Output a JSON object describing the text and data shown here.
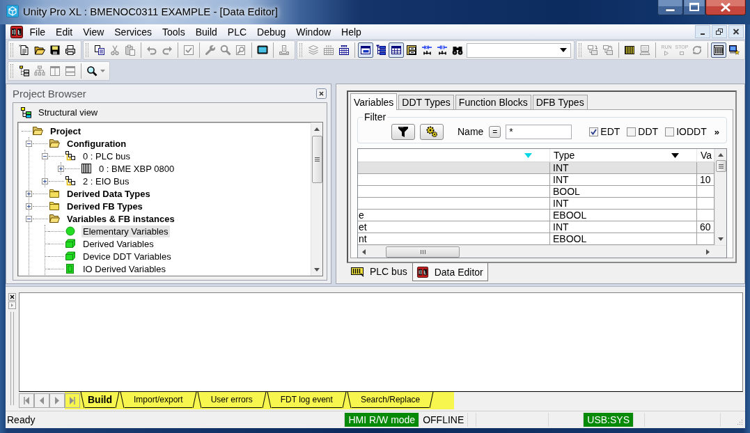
{
  "window": {
    "title": "Unity Pro XL : BMENOC0311 EXAMPLE - [Data Editor]"
  },
  "menu": [
    "File",
    "Edit",
    "View",
    "Services",
    "Tools",
    "Build",
    "PLC",
    "Debug",
    "Window",
    "Help"
  ],
  "toolbar_rows": [
    {
      "bands": [
        {
          "groups": [
            [
              {
                "kind": "new",
                "disabled": false,
                "pressed": false
              },
              {
                "kind": "open",
                "disabled": false,
                "pressed": false
              },
              {
                "kind": "save",
                "disabled": false,
                "pressed": false
              },
              {
                "kind": "print",
                "disabled": false,
                "pressed": false
              }
            ]
          ]
        },
        {
          "groups": [
            [
              {
                "kind": "copy",
                "disabled": false,
                "pressed": false
              },
              {
                "kind": "cut",
                "disabled": true,
                "pressed": false
              },
              {
                "kind": "paste",
                "disabled": true,
                "pressed": false
              }
            ],
            [
              {
                "kind": "undo",
                "disabled": true,
                "pressed": false
              },
              {
                "kind": "redo",
                "disabled": true,
                "pressed": false
              }
            ],
            [
              {
                "kind": "check",
                "disabled": true,
                "pressed": false
              }
            ],
            [
              {
                "kind": "wrench",
                "disabled": true,
                "pressed": false
              },
              {
                "kind": "magnifier",
                "disabled": true,
                "pressed": false
              },
              {
                "kind": "zoompage",
                "disabled": true,
                "pressed": false
              }
            ],
            [
              {
                "kind": "monitor",
                "disabled": false,
                "pressed": false
              }
            ],
            [
              {
                "kind": "export",
                "disabled": true,
                "pressed": false
              }
            ]
          ]
        },
        {
          "groups": [
            [
              {
                "kind": "stack",
                "disabled": true,
                "pressed": false
              },
              {
                "kind": "grid",
                "disabled": true,
                "pressed": false
              },
              {
                "kind": "gridin",
                "disabled": false,
                "pressed": false
              }
            ],
            [
              {
                "kind": "window",
                "disabled": false,
                "pressed": true
              },
              {
                "kind": "tree",
                "disabled": false,
                "pressed": false
              },
              {
                "kind": "table",
                "disabled": false,
                "pressed": true
              },
              {
                "kind": "cabinet",
                "disabled": false,
                "pressed": false
              },
              {
                "kind": "contact",
                "disabled": false,
                "pressed": false
              },
              {
                "kind": "coil",
                "disabled": false,
                "pressed": false
              },
              {
                "kind": "binoculars",
                "disabled": false,
                "pressed": false
              }
            ]
          ],
          "combo": true
        },
        {
          "groups": [
            [
              {
                "kind": "download",
                "disabled": true,
                "pressed": false
              },
              {
                "kind": "upload",
                "disabled": true,
                "pressed": false
              }
            ],
            [
              {
                "kind": "rack",
                "disabled": false,
                "pressed": false
              },
              {
                "kind": "computer",
                "disabled": true,
                "pressed": false
              }
            ],
            [
              {
                "kind": "run",
                "label": "RUN",
                "disabled": true,
                "pressed": false
              },
              {
                "kind": "stop",
                "label": "STOP",
                "disabled": true,
                "pressed": false
              },
              {
                "kind": "cycle",
                "disabled": true,
                "pressed": false
              }
            ],
            [
              {
                "kind": "rackview",
                "disabled": false,
                "pressed": true
              },
              {
                "kind": "station",
                "disabled": false,
                "pressed": false
              }
            ]
          ]
        }
      ]
    },
    {
      "bands": [
        {
          "groups": [
            [
              {
                "kind": "treeview",
                "disabled": false,
                "pressed": false
              },
              {
                "kind": "hierarchy",
                "disabled": true,
                "pressed": false
              },
              {
                "kind": "columns",
                "disabled": true,
                "pressed": false
              },
              {
                "kind": "rows",
                "disabled": true,
                "pressed": false
              }
            ],
            [
              {
                "kind": "zoom",
                "disabled": false,
                "pressed": false
              }
            ]
          ]
        }
      ]
    }
  ],
  "project_browser": {
    "title": "Project Browser",
    "view": "Structural view",
    "tree": [
      {
        "label": "Project",
        "kind": "folder",
        "expanded": true,
        "selected": false,
        "children": [
          {
            "label": "Configuration",
            "kind": "folder",
            "expanded": true,
            "selected": false,
            "children": [
              {
                "label": "0 : PLC bus",
                "kind": "bus",
                "expanded": true,
                "selected": false,
                "children": [
                  {
                    "label": "0 : BME XBP 0800",
                    "kind": "rack",
                    "expanded": false,
                    "selected": false
                  }
                ]
              },
              {
                "label": "2 : EIO Bus",
                "kind": "bus",
                "expanded": false,
                "selected": false
              }
            ]
          },
          {
            "label": "Derived Data Types",
            "kind": "folder",
            "expanded": false,
            "selected": false
          },
          {
            "label": "Derived FB Types",
            "kind": "folder",
            "expanded": false,
            "selected": false
          },
          {
            "label": "Variables & FB instances",
            "kind": "folder",
            "expanded": true,
            "selected": false,
            "children": [
              {
                "label": "Elementary Variables",
                "kind": "elementary",
                "selected": true
              },
              {
                "label": "Derived Variables",
                "kind": "derived",
                "selected": false
              },
              {
                "label": "Device DDT Variables",
                "kind": "device",
                "selected": false
              },
              {
                "label": "IO Derived Variables",
                "kind": "io",
                "selected": false
              }
            ]
          }
        ]
      }
    ]
  },
  "data_editor": {
    "tabs": [
      {
        "label": "Variables",
        "selected": true
      },
      {
        "label": "DDT Types",
        "selected": false
      },
      {
        "label": "Function Blocks",
        "selected": false
      },
      {
        "label": "DFB Types",
        "selected": false
      }
    ],
    "filter": {
      "legend": "Filter",
      "name_label": "Name",
      "operator": "=",
      "value": "*",
      "types": [
        {
          "label": "EDT",
          "checked": true
        },
        {
          "label": "DDT",
          "checked": false
        },
        {
          "label": "IODDT",
          "checked": false
        }
      ],
      "more": "»"
    },
    "table": {
      "columns": [
        {
          "sorted": true,
          "filter_menu": true
        },
        {
          "label": "Type",
          "sorted": false,
          "filter_menu": true
        },
        {
          "label": "Va",
          "sorted": false,
          "filter_menu": false
        }
      ],
      "rows": [
        {
          "type": "INT",
          "selected": true
        },
        {
          "type": "INT",
          "column_3": "10",
          "selected": false
        },
        {
          "type": "BOOL",
          "selected": false
        },
        {
          "type": "INT",
          "selected": false
        },
        {
          "column_1": "e",
          "type": "EBOOL",
          "selected": false
        },
        {
          "column_1": "et",
          "type": "INT",
          "column_3": "60",
          "selected": false
        },
        {
          "column_1": "nt",
          "type": "EBOOL",
          "selected": false
        }
      ]
    },
    "windows": [
      {
        "label": "PLC bus",
        "kind": "bus",
        "selected": false
      },
      {
        "label": "Data Editor",
        "kind": "editor",
        "selected": true
      }
    ]
  },
  "output": {
    "highlighted": true,
    "tabs": [
      {
        "label": "Build",
        "selected": true
      },
      {
        "label": "Import/export",
        "selected": false
      },
      {
        "label": "User errors",
        "selected": false
      },
      {
        "label": "FDT log event",
        "selected": false
      },
      {
        "label": "Search/Replace",
        "selected": false
      }
    ]
  },
  "status_bar": [
    {
      "text": "Ready"
    },
    {
      "text": "HMI R/W mode",
      "color": "#078a07"
    },
    {
      "text": "OFFLINE"
    },
    {
      "text": "USB:SYS",
      "color": "#078a07"
    }
  ]
}
